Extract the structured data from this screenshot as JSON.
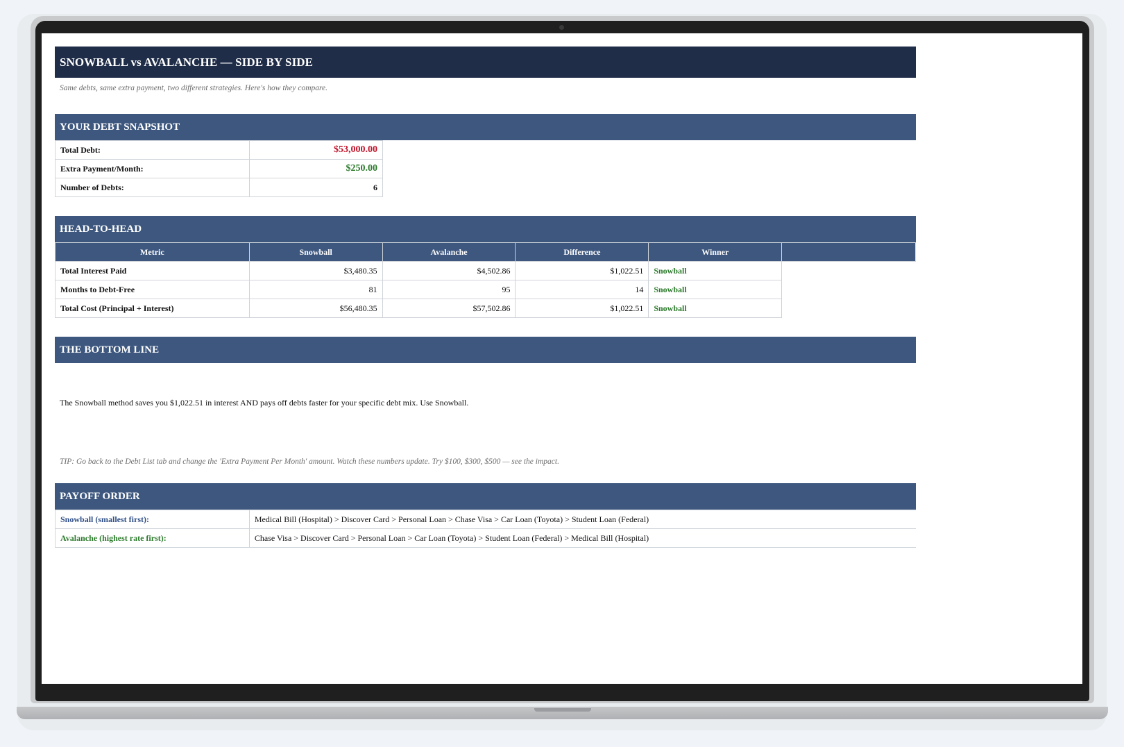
{
  "title": "SNOWBALL vs AVALANCHE — SIDE BY SIDE",
  "subtitle": "Same debts, same extra payment, two different strategies. Here's how they compare.",
  "snapshot": {
    "header": "YOUR DEBT SNAPSHOT",
    "rows": [
      {
        "label": "Total Debt:",
        "value": "$53,000.00"
      },
      {
        "label": "Extra Payment/Month:",
        "value": "$250.00"
      },
      {
        "label": "Number of Debts:",
        "value": "6"
      }
    ]
  },
  "head_to_head": {
    "header": "HEAD-TO-HEAD",
    "columns": [
      "Metric",
      "Snowball",
      "Avalanche",
      "Difference",
      "Winner"
    ],
    "rows": [
      {
        "metric": "Total Interest Paid",
        "snowball": "$3,480.35",
        "avalanche": "$4,502.86",
        "difference": "$1,022.51",
        "winner": "Snowball"
      },
      {
        "metric": "Months to Debt-Free",
        "snowball": "81",
        "avalanche": "95",
        "difference": "14",
        "winner": "Snowball"
      },
      {
        "metric": "Total Cost (Principal + Interest)",
        "snowball": "$56,480.35",
        "avalanche": "$57,502.86",
        "difference": "$1,022.51",
        "winner": "Snowball"
      }
    ]
  },
  "bottom_line": {
    "header": "THE BOTTOM LINE",
    "text": "The Snowball method saves you $1,022.51 in interest AND pays off debts faster for your specific debt mix. Use Snowball.",
    "tip": "TIP: Go back to the Debt List tab and change the 'Extra Payment Per Month' amount. Watch these numbers update. Try $100, $300, $500 — see the impact."
  },
  "payoff_order": {
    "header": "PAYOFF ORDER",
    "snowball_label": "Snowball (smallest first):",
    "snowball_order": "Medical Bill (Hospital) > Discover Card > Personal Loan > Chase Visa > Car Loan (Toyota) > Student Loan (Federal)",
    "avalanche_label": "Avalanche (highest rate first):",
    "avalanche_order": "Chase Visa > Discover Card > Personal Loan > Car Loan (Toyota) > Student Loan (Federal) > Medical Bill (Hospital)"
  },
  "colors": {
    "title_bar": "#1f2d48",
    "section_bar": "#3d577f",
    "total_debt": "#c0152b",
    "positive": "#2b7a2b"
  }
}
